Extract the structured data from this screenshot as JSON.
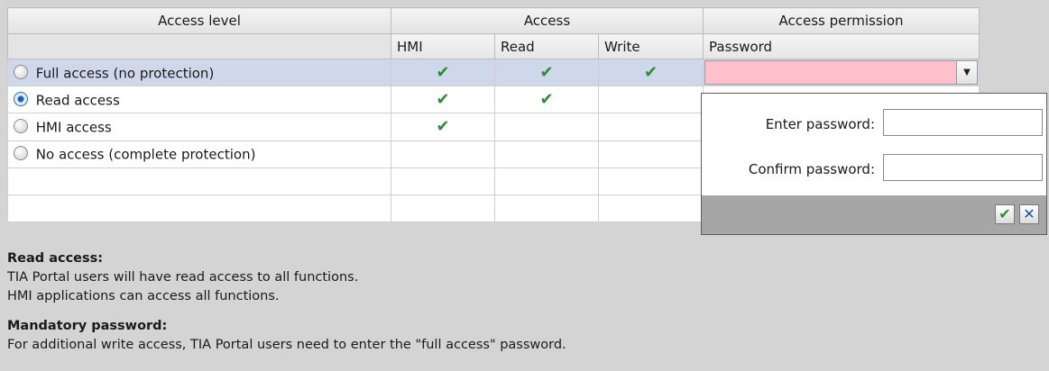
{
  "table": {
    "headers_top": {
      "access_level": "Access level",
      "access": "Access",
      "access_permission": "Access permission"
    },
    "headers_sub": {
      "hmi": "HMI",
      "read": "Read",
      "write": "Write",
      "password": "Password"
    },
    "rows": [
      {
        "label": "Full access (no protection)",
        "selected": false,
        "highlighted": true,
        "hmi": "✔",
        "read": "✔",
        "write": "✔"
      },
      {
        "label": "Read access",
        "selected": true,
        "highlighted": false,
        "hmi": "✔",
        "read": "✔",
        "write": ""
      },
      {
        "label": "HMI access",
        "selected": false,
        "highlighted": false,
        "hmi": "✔",
        "read": "",
        "write": ""
      },
      {
        "label": "No access (complete protection)",
        "selected": false,
        "highlighted": false,
        "hmi": "",
        "read": "",
        "write": ""
      }
    ]
  },
  "password_popup": {
    "enter_label": "Enter password:",
    "confirm_label": "Confirm password:",
    "enter_value": "",
    "confirm_value": ""
  },
  "description": {
    "read_access_heading": "Read access:",
    "read_access_line1": "TIA Portal users will have read access to all functions.",
    "read_access_line2": "HMI applications can access all functions.",
    "mandatory_heading": "Mandatory password:",
    "mandatory_line1": "For additional write access, TIA Portal users need to enter the \"full access\" password."
  },
  "colors": {
    "check": "#2e8b36",
    "password_field": "#ffc0cb",
    "selected_row": "#cfd8ea",
    "cancel": "#1e4fb8"
  }
}
